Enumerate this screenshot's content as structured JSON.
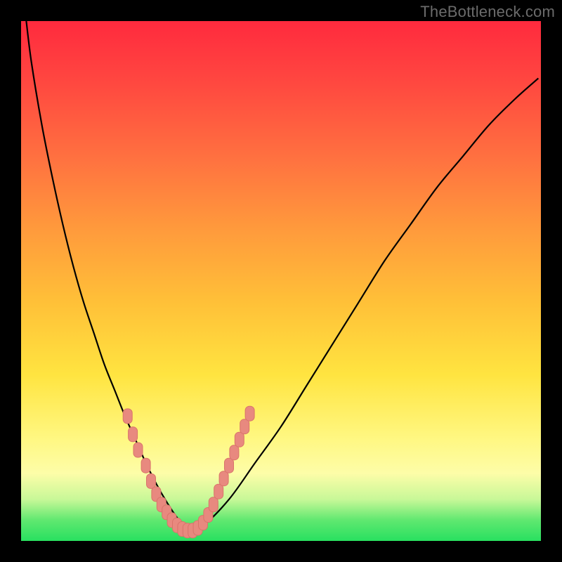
{
  "watermark": "TheBottleneck.com",
  "colors": {
    "bg": "#000000",
    "grad_top": "#ff2a3e",
    "grad_bottom": "#28e060",
    "curve": "#000000",
    "marker_fill": "#e8897f",
    "marker_stroke": "#d9746a"
  },
  "chart_data": {
    "type": "line",
    "title": "",
    "xlabel": "",
    "ylabel": "",
    "xlim": [
      0,
      100
    ],
    "ylim": [
      0,
      100
    ],
    "x": [
      1,
      2,
      4,
      6,
      8,
      10,
      12,
      14,
      16,
      18,
      20,
      22,
      24,
      26,
      28,
      30,
      32,
      35,
      40,
      45,
      50,
      55,
      60,
      65,
      70,
      75,
      80,
      85,
      90,
      95,
      99.5
    ],
    "values": [
      100,
      92,
      80,
      70,
      61,
      53,
      46,
      40,
      34,
      29,
      24,
      19.5,
      15,
      11,
      7.5,
      4.5,
      2.5,
      3,
      8,
      15,
      22,
      30,
      38,
      46,
      54,
      61,
      68,
      74,
      80,
      85,
      89
    ],
    "marker_points": [
      {
        "x": 20.5,
        "y": 24
      },
      {
        "x": 21.5,
        "y": 20.5
      },
      {
        "x": 22.5,
        "y": 17.5
      },
      {
        "x": 24.0,
        "y": 14.5
      },
      {
        "x": 25.0,
        "y": 11.5
      },
      {
        "x": 26.0,
        "y": 9.0
      },
      {
        "x": 27.0,
        "y": 7.0
      },
      {
        "x": 28.0,
        "y": 5.5
      },
      {
        "x": 29.0,
        "y": 4.0
      },
      {
        "x": 30.0,
        "y": 3.0
      },
      {
        "x": 31.0,
        "y": 2.3
      },
      {
        "x": 32.0,
        "y": 2.0
      },
      {
        "x": 33.0,
        "y": 2.0
      },
      {
        "x": 34.0,
        "y": 2.5
      },
      {
        "x": 35.0,
        "y": 3.5
      },
      {
        "x": 36.0,
        "y": 5.0
      },
      {
        "x": 37.0,
        "y": 7.0
      },
      {
        "x": 38.0,
        "y": 9.5
      },
      {
        "x": 39.0,
        "y": 12.0
      },
      {
        "x": 40.0,
        "y": 14.5
      },
      {
        "x": 41.0,
        "y": 17.0
      },
      {
        "x": 42.0,
        "y": 19.5
      },
      {
        "x": 43.0,
        "y": 22.0
      },
      {
        "x": 44.0,
        "y": 24.5
      }
    ]
  }
}
